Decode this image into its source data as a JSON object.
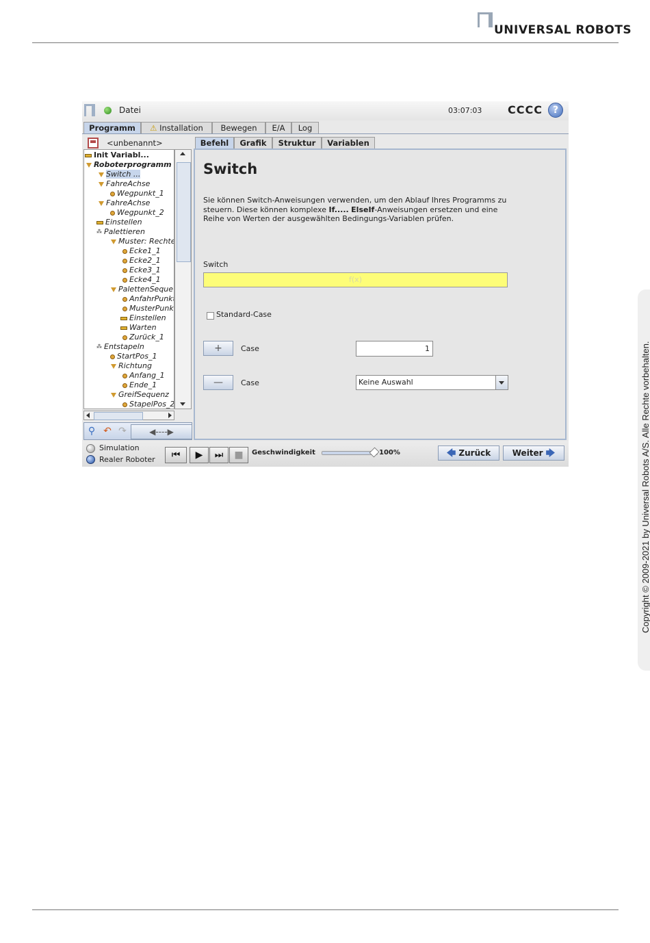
{
  "page": {
    "brand": "UNIVERSAL ROBOTS",
    "copyright": "Copyright © 2009-2021 by Universal Robots A/S. Alle Rechte vorbehalten."
  },
  "topbar": {
    "file_label": "Datei",
    "time": "03:07:03",
    "robot_name": "CCCC",
    "help_icon": "?"
  },
  "main_tabs": [
    {
      "label": "Programm",
      "active": true
    },
    {
      "label": "Installation",
      "warning_icon": "⚠"
    },
    {
      "label": "Bewegen"
    },
    {
      "label": "E/A"
    },
    {
      "label": "Log"
    }
  ],
  "program": {
    "name": "<unbenannt>"
  },
  "tree": [
    {
      "label": "Init Variabl...",
      "icon": "bar",
      "style": "bold-plain"
    },
    {
      "label": "Roboterprogramm",
      "icon": "triangle",
      "style": "bold"
    },
    {
      "label": "Switch ...",
      "icon": "triangle",
      "selected": true
    },
    {
      "label": "FahreAchse",
      "icon": "triangle"
    },
    {
      "label": "Wegpunkt_1",
      "icon": "dot"
    },
    {
      "label": "FahreAchse",
      "icon": "triangle"
    },
    {
      "label": "Wegpunkt_2",
      "icon": "dot"
    },
    {
      "label": "Einstellen",
      "icon": "bar"
    },
    {
      "label": "Palettieren",
      "icon": "pallet"
    },
    {
      "label": "Muster: Rechte",
      "icon": "triangle"
    },
    {
      "label": "Ecke1_1",
      "icon": "dot"
    },
    {
      "label": "Ecke2_1",
      "icon": "dot"
    },
    {
      "label": "Ecke3_1",
      "icon": "dot"
    },
    {
      "label": "Ecke4_1",
      "icon": "dot"
    },
    {
      "label": "PalettenSeque",
      "icon": "triangle"
    },
    {
      "label": "AnfahrPunkt",
      "icon": "dot"
    },
    {
      "label": "MusterPunkt",
      "icon": "dot"
    },
    {
      "label": "Einstellen",
      "icon": "bar"
    },
    {
      "label": "Warten",
      "icon": "bar"
    },
    {
      "label": "Zurück_1",
      "icon": "dot"
    },
    {
      "label": "Entstapeln",
      "icon": "pallet"
    },
    {
      "label": "StartPos_1",
      "icon": "dot"
    },
    {
      "label": "Richtung",
      "icon": "triangle"
    },
    {
      "label": "Anfang_1",
      "icon": "dot"
    },
    {
      "label": "Ende_1",
      "icon": "dot"
    },
    {
      "label": "GreifSequenz",
      "icon": "triangle"
    },
    {
      "label": "StapelPos_2",
      "icon": "dot"
    }
  ],
  "tree_tools": {
    "search_icon": "search-icon",
    "undo_icon": "undo-icon",
    "redo_icon": "redo-icon",
    "nav_label": "◀----▶"
  },
  "sub_tabs": [
    {
      "label": "Befehl",
      "active": true
    },
    {
      "label": "Grafik"
    },
    {
      "label": "Struktur"
    },
    {
      "label": "Variablen"
    }
  ],
  "content": {
    "title": "Switch",
    "desc_1": "Sie können Switch-Anweisungen verwenden, um den Ablauf Ihres Programms zu steuern. Diese können komplexe ",
    "desc_bold_1": "If.....",
    "desc_mid": " ",
    "desc_bold_2": "ElseIf",
    "desc_2": "-Anweisungen ersetzen und eine Reihe von Werten der ausgewählten Bedingungs-Variablen prüfen.",
    "switch_label": "Switch",
    "fx_placeholder": "f(x)",
    "default_case_label": "Standard-Case",
    "default_case_checked": false,
    "add_case_label": "Case",
    "add_case_value": "1",
    "remove_case_label": "Case",
    "remove_case_selected": "Keine Auswahl"
  },
  "bottom": {
    "simulation_label": "Simulation",
    "real_robot_label": "Realer Roboter",
    "mode": "Realer Roboter",
    "speed_label": "Geschwindigkeit",
    "speed_value": "100%",
    "speed_fraction": 1.0,
    "back_label": "Zurück",
    "next_label": "Weiter"
  },
  "colors": {
    "accent_tab": "#c7d5ea",
    "fx_field": "#fdfd78",
    "panel_border": "#a6b7cf"
  }
}
